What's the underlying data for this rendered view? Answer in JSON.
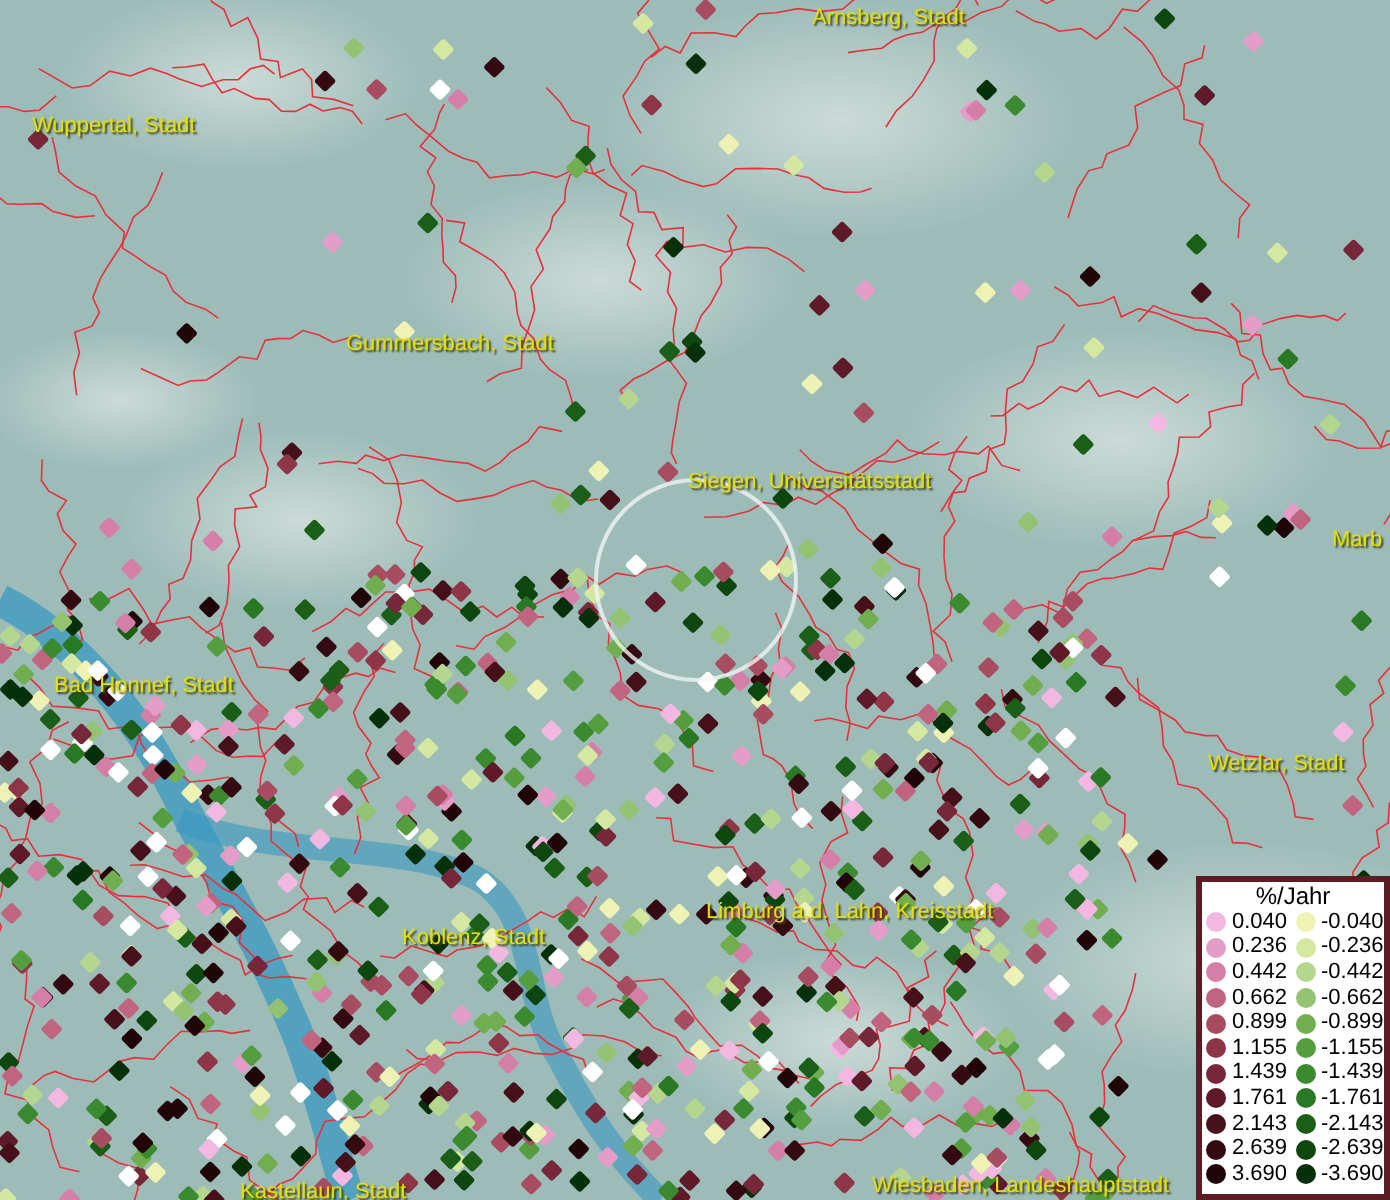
{
  "map": {
    "places": [
      {
        "name": "Arnsberg, Stadt"
      },
      {
        "name": "Wuppertal, Stadt"
      },
      {
        "name": "Gummersbach, Stadt"
      },
      {
        "name": "Siegen, Universitätsstadt"
      },
      {
        "name": "Marb"
      },
      {
        "name": "Bad Honnef, Stadt"
      },
      {
        "name": "Wetzlar, Stadt"
      },
      {
        "name": "Koblenz, Stadt"
      },
      {
        "name": "Limburg a.d. Lahn, Kreisstadt"
      },
      {
        "name": "Kastellaun, Stadt"
      },
      {
        "name": "Wiesbaden, Landeshauptstadt"
      }
    ]
  },
  "legend": {
    "title": "%/Jahr",
    "positive": [
      {
        "value": "0.040",
        "color": "#f2b8e2"
      },
      {
        "value": "0.236",
        "color": "#e49cc8"
      },
      {
        "value": "0.442",
        "color": "#d47ea8"
      },
      {
        "value": "0.662",
        "color": "#c0647f"
      },
      {
        "value": "0.899",
        "color": "#a84c62"
      },
      {
        "value": "1.155",
        "color": "#8e3648"
      },
      {
        "value": "1.439",
        "color": "#76283a"
      },
      {
        "value": "1.761",
        "color": "#5e1a28"
      },
      {
        "value": "2.143",
        "color": "#46101a"
      },
      {
        "value": "2.639",
        "color": "#340a12"
      },
      {
        "value": "3.690",
        "color": "#200408"
      }
    ],
    "negative": [
      {
        "value": "-0.040",
        "color": "#eef2b4"
      },
      {
        "value": "-0.236",
        "color": "#d4e8a2"
      },
      {
        "value": "-0.442",
        "color": "#b4d68e"
      },
      {
        "value": "-0.662",
        "color": "#92c272"
      },
      {
        "value": "-0.899",
        "color": "#70ae50"
      },
      {
        "value": "-1.155",
        "color": "#549e40"
      },
      {
        "value": "-1.439",
        "color": "#3c8a30"
      },
      {
        "value": "-1.761",
        "color": "#287824"
      },
      {
        "value": "-2.143",
        "color": "#1a5e18"
      },
      {
        "value": "-2.639",
        "color": "#0e4610"
      },
      {
        "value": "-3.690",
        "color": "#06300a"
      }
    ]
  }
}
